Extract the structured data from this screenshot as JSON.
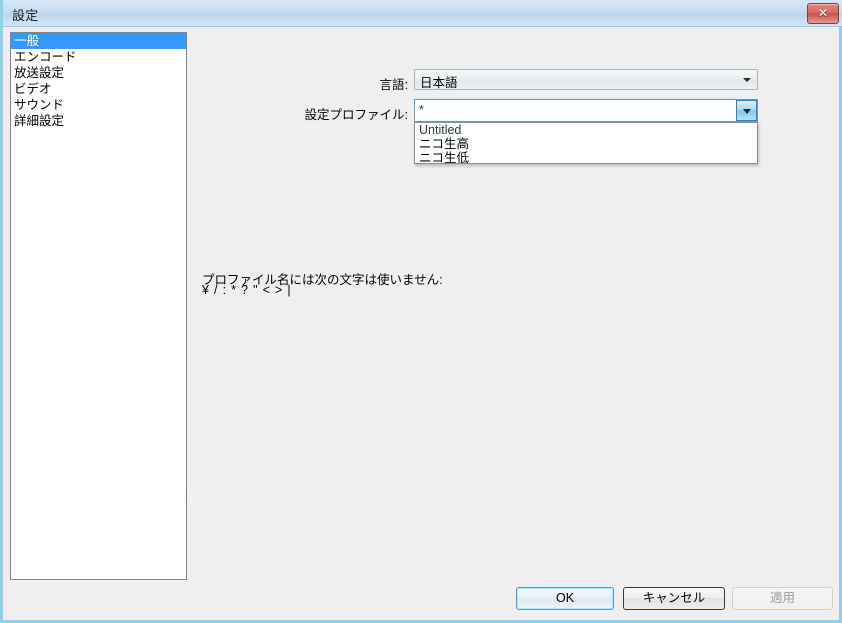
{
  "window": {
    "title": "設定",
    "close_label": "✕"
  },
  "sidebar": {
    "items": [
      {
        "label": "一般"
      },
      {
        "label": "エンコード"
      },
      {
        "label": "放送設定"
      },
      {
        "label": "ビデオ"
      },
      {
        "label": "サウンド"
      },
      {
        "label": "詳細設定"
      }
    ]
  },
  "general_page": {
    "language": {
      "label": "言語:",
      "value": "日本語"
    },
    "profile": {
      "label": "設定プロファイル:",
      "value": "*",
      "options": [
        {
          "label": "Untitled"
        },
        {
          "label": "ニコ生高"
        },
        {
          "label": "ニコ生低"
        }
      ]
    },
    "hint_line1": "プロファイル名には次の文字は使いません:",
    "hint_line2": "¥ / : * ? \" < > |"
  },
  "footer": {
    "ok_label": "OK",
    "cancel_label": "キャンセル",
    "apply_label": "適用"
  },
  "colors": {
    "selection": "#3399ff",
    "window_border": "#8fd0ec",
    "close_button": "#c85346",
    "focus_border": "#5a9ed4"
  }
}
